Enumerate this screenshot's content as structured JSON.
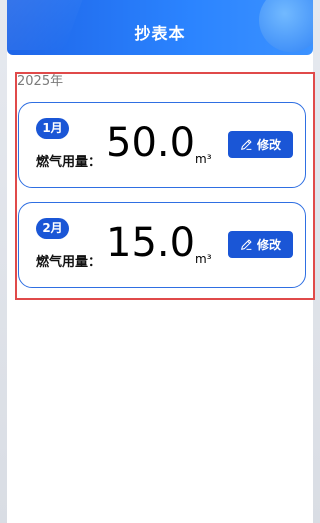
{
  "header": {
    "title": "抄表本"
  },
  "year_label": "2025年",
  "records": [
    {
      "month": "1月",
      "label": "燃气用量：",
      "value": "50.0",
      "unit": "m³",
      "edit_label": "修改"
    },
    {
      "month": "2月",
      "label": "燃气用量：",
      "value": "15.0",
      "unit": "m³",
      "edit_label": "修改"
    }
  ],
  "colors": {
    "primary": "#1a56d6",
    "card_border": "#2f6fe2",
    "highlight_border": "#e04a4a"
  },
  "icons": {
    "edit": "pencil-icon"
  }
}
